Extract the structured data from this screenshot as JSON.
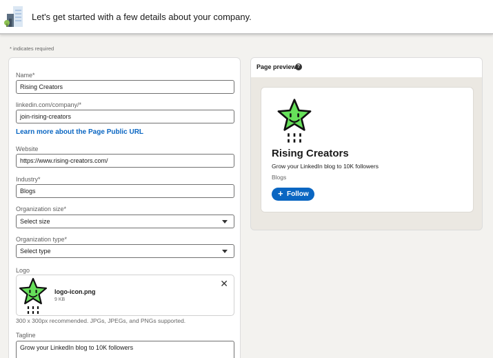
{
  "header": {
    "title": "Let's get started with a few details about your company."
  },
  "required_note": "* indicates required",
  "form": {
    "name": {
      "label": "Name*",
      "value": "Rising Creators"
    },
    "url": {
      "label": "linkedin.com/company/*",
      "value": "join-rising-creators"
    },
    "learn_more": "Learn more about the Page Public URL",
    "website": {
      "label": "Website",
      "value": "https://www.rising-creators.com/"
    },
    "industry": {
      "label": "Industry*",
      "value": "Blogs"
    },
    "org_size": {
      "label": "Organization size*",
      "selected": "Select size"
    },
    "org_type": {
      "label": "Organization type*",
      "selected": "Select type"
    },
    "logo": {
      "label": "Logo",
      "file_name": "logo-icon.png",
      "file_size": "9 KB",
      "hint": "300 x 300px recommended. JPGs, JPEGs, and PNGs supported.",
      "close_glyph": "✕"
    },
    "tagline": {
      "label": "Tagline",
      "value": "Grow your LinkedIn blog to 10K followers"
    }
  },
  "preview": {
    "title": "Page preview",
    "help_glyph": "?",
    "name": "Rising Creators",
    "tagline": "Grow your LinkedIn blog to 10K followers",
    "industry": "Blogs",
    "follow_plus": "+",
    "follow_label": "Follow"
  },
  "icons": {
    "header": "building-illustration-icon",
    "logo": "star-logo-icon",
    "close": "close-icon",
    "help": "help-icon",
    "caret": "chevron-down-icon",
    "plus": "plus-icon"
  },
  "colors": {
    "brand_blue": "#0a66c2",
    "star_green": "#66e05a",
    "page_bg": "#f3f2ef"
  }
}
